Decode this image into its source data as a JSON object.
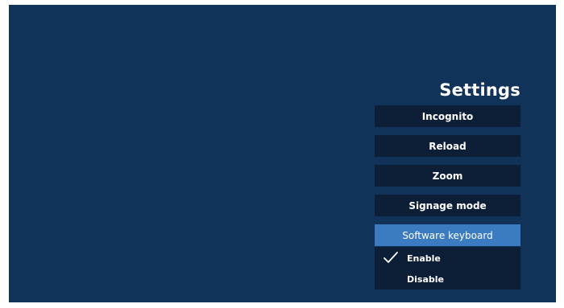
{
  "settings": {
    "title": "Settings",
    "items": [
      {
        "label": "Incognito"
      },
      {
        "label": "Reload"
      },
      {
        "label": "Zoom"
      },
      {
        "label": "Signage mode"
      },
      {
        "label": "Software keyboard",
        "selected": true
      }
    ],
    "submenu": {
      "options": [
        {
          "label": "Enable",
          "checked": true
        },
        {
          "label": "Disable",
          "checked": false
        }
      ]
    }
  },
  "colors": {
    "background": "#11335a",
    "button": "#0d1f36",
    "selected": "#3a7bc1",
    "text": "#ffffff"
  },
  "icons": {
    "checked_option": "checkmark-icon"
  }
}
